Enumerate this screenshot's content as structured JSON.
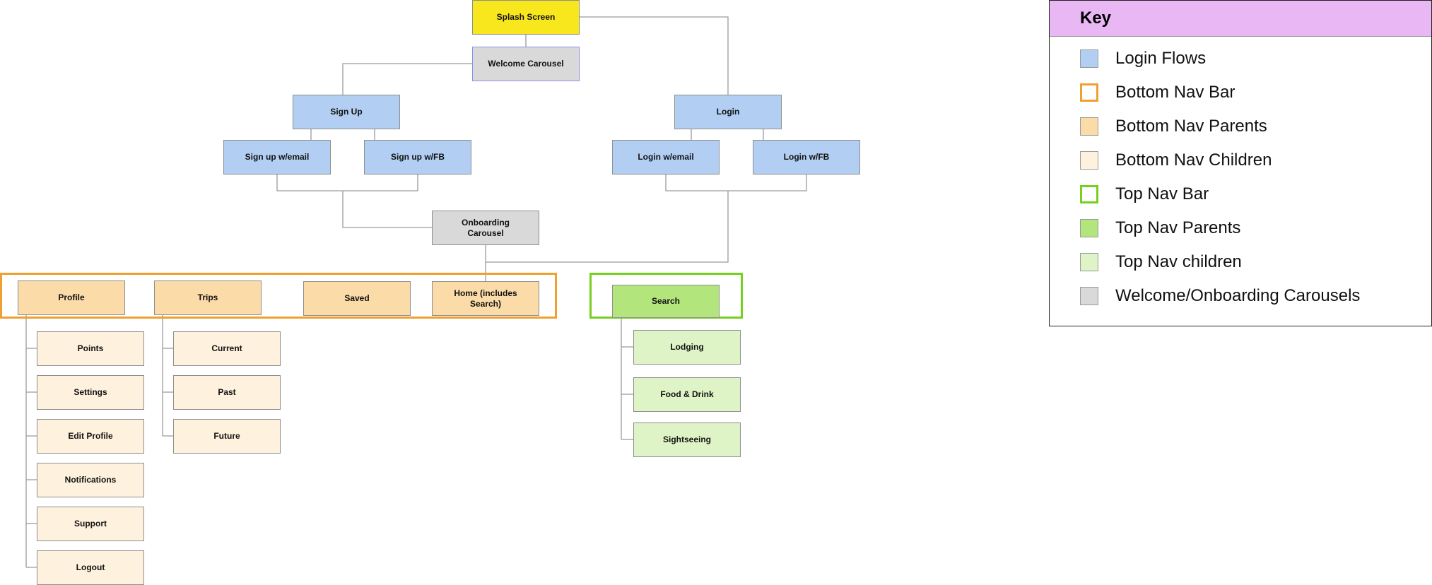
{
  "colors": {
    "login": "#b2cff3",
    "splash": "#f9e71e",
    "carousel": "#d9d9d9",
    "bottom_bar": "#f0a030",
    "bottom_parent": "#fbdba8",
    "bottom_child": "#fef1dd",
    "top_bar": "#77d020",
    "top_parent": "#b3e57d",
    "top_child": "#def3c6",
    "key_header": "#e9b8f4"
  },
  "nodes": {
    "splash": "Splash Screen",
    "welcome": "Welcome Carousel",
    "signup": "Sign Up",
    "signup_email": "Sign up w/email",
    "signup_fb": "Sign up w/FB",
    "login": "Login",
    "login_email": "Login w/email",
    "login_fb": "Login w/FB",
    "onboarding": "Onboarding Carousel",
    "profile": "Profile",
    "trips": "Trips",
    "saved": "Saved",
    "home": "Home (includes Search)",
    "profile_children": [
      "Points",
      "Settings",
      "Edit Profile",
      "Notifications",
      "Support",
      "Logout"
    ],
    "trips_children": [
      "Current",
      "Past",
      "Future"
    ],
    "search": "Search",
    "search_children": [
      "Lodging",
      "Food & Drink",
      "Sightseeing"
    ]
  },
  "key": {
    "title": "Key",
    "items": [
      {
        "label": "Login Flows",
        "color": "#b2cff3",
        "style": "fill"
      },
      {
        "label": "Bottom Nav Bar",
        "color": "#f0a030",
        "style": "outline"
      },
      {
        "label": "Bottom Nav Parents",
        "color": "#fbdba8",
        "style": "fill"
      },
      {
        "label": "Bottom Nav Children",
        "color": "#fef1dd",
        "style": "fill"
      },
      {
        "label": "Top Nav Bar",
        "color": "#77d020",
        "style": "outline"
      },
      {
        "label": "Top Nav Parents",
        "color": "#b3e57d",
        "style": "fill"
      },
      {
        "label": "Top Nav children",
        "color": "#def3c6",
        "style": "fill"
      },
      {
        "label": "Welcome/Onboarding Carousels",
        "color": "#d9d9d9",
        "style": "fill"
      }
    ]
  }
}
